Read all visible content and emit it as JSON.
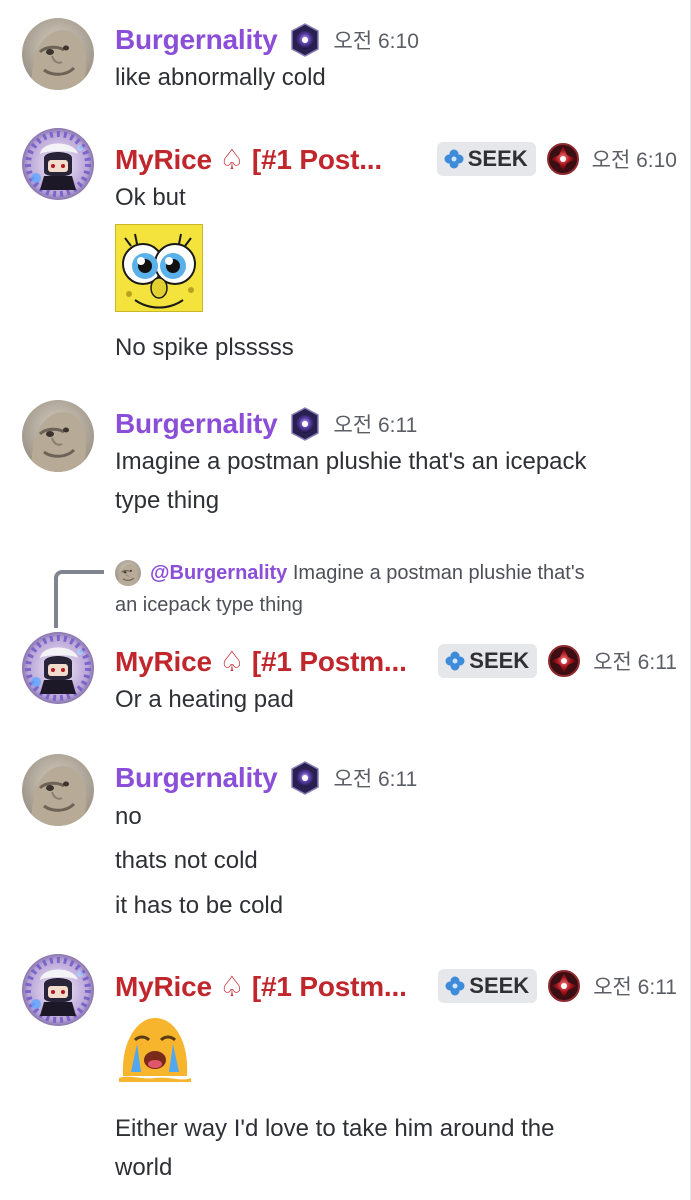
{
  "messages": [
    {
      "author": "Burgernality",
      "timestamp": "오전 6:10",
      "avatar_icon": "stone-face-avatar",
      "lines": [
        "like abnormally cold"
      ]
    },
    {
      "author": "MyRice ♤ [#1 Post...",
      "tag": "SEEK",
      "timestamp": "오전 6:10",
      "avatar_icon": "anime-character-avatar",
      "lines": [
        "Ok but",
        "No spike plsssss"
      ],
      "sticker": "spongebob-pleading-eyes-emoji"
    },
    {
      "author": "Burgernality",
      "timestamp": "오전 6:11",
      "avatar_icon": "stone-face-avatar",
      "lines": [
        "Imagine a postman plushie that's an icepack",
        "type thing"
      ]
    },
    {
      "reply": {
        "author": "@Burgernality",
        "text_line1": "Imagine a postman plushie that's",
        "text_line2": "an icepack type thing"
      },
      "author": "MyRice ♤ [#1 Postm...",
      "tag": "SEEK",
      "timestamp": "오전 6:11",
      "avatar_icon": "anime-character-avatar",
      "lines": [
        "Or a heating pad"
      ]
    },
    {
      "author": "Burgernality",
      "timestamp": "오전 6:11",
      "avatar_icon": "stone-face-avatar",
      "lines": [
        "no",
        "thats not cold",
        "it has to be cold"
      ]
    },
    {
      "author": "MyRice ♤ [#1 Postm...",
      "tag": "SEEK",
      "timestamp": "오전 6:11",
      "avatar_icon": "anime-character-avatar",
      "lines": [
        "Either way I'd love to take him around the",
        "world"
      ],
      "sticker": "crying-melting-face-emoji"
    }
  ],
  "colors": {
    "burgernality_name": "#8a4ed8",
    "myrice_name": "#c0272d",
    "message_text": "#2e3035",
    "timestamp": "#5c5e66",
    "tag_bg": "#e6e7ea"
  }
}
